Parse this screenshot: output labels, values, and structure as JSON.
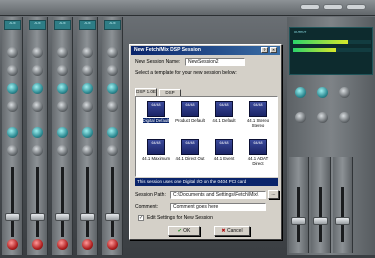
{
  "dialog": {
    "title": "New Fetch/Mix DSP Session",
    "name_label": "New Session Name:",
    "name_value": "NewSession2",
    "template_prompt": "Select a template for your new session below:",
    "tabs": [
      {
        "label": "DSP 1.0E"
      },
      {
        "label": "DSP"
      }
    ],
    "templates": [
      {
        "icon_label": "64/48",
        "label": "Digital Default"
      },
      {
        "icon_label": "64/48",
        "label": "Product Default"
      },
      {
        "icon_label": "64/48",
        "label": "44.1 Default"
      },
      {
        "icon_label": "64/48",
        "label": "44.1 Stereo Stereo"
      },
      {
        "icon_label": "64/48",
        "label": "44.1 Maximum"
      },
      {
        "icon_label": "64/48",
        "label": "44.1 Direct Out"
      },
      {
        "icon_label": "64/48",
        "label": "44.1 Event"
      },
      {
        "icon_label": "64/48",
        "label": "44.1 ADAT Direct"
      }
    ],
    "info_text": "This session uses one Digital I/O on the 0404 PCI card",
    "session_path_label": "Session Path:",
    "session_path_value": "C:\\Documents and Settings\\Fetch\\Mix\\",
    "browse_label": "...",
    "comment_label": "Comment:",
    "comment_value": "Comment goes here",
    "edit_settings_label": "Edit Settings for New Session",
    "ok_label": "OK",
    "cancel_label": "Cancel"
  },
  "mixer": {
    "channel_lcds": [
      "AUX",
      "AUX",
      "AUX",
      "AUX",
      "AUX"
    ],
    "meter_lines": [
      "OUTPUT",
      "L",
      "R"
    ]
  }
}
